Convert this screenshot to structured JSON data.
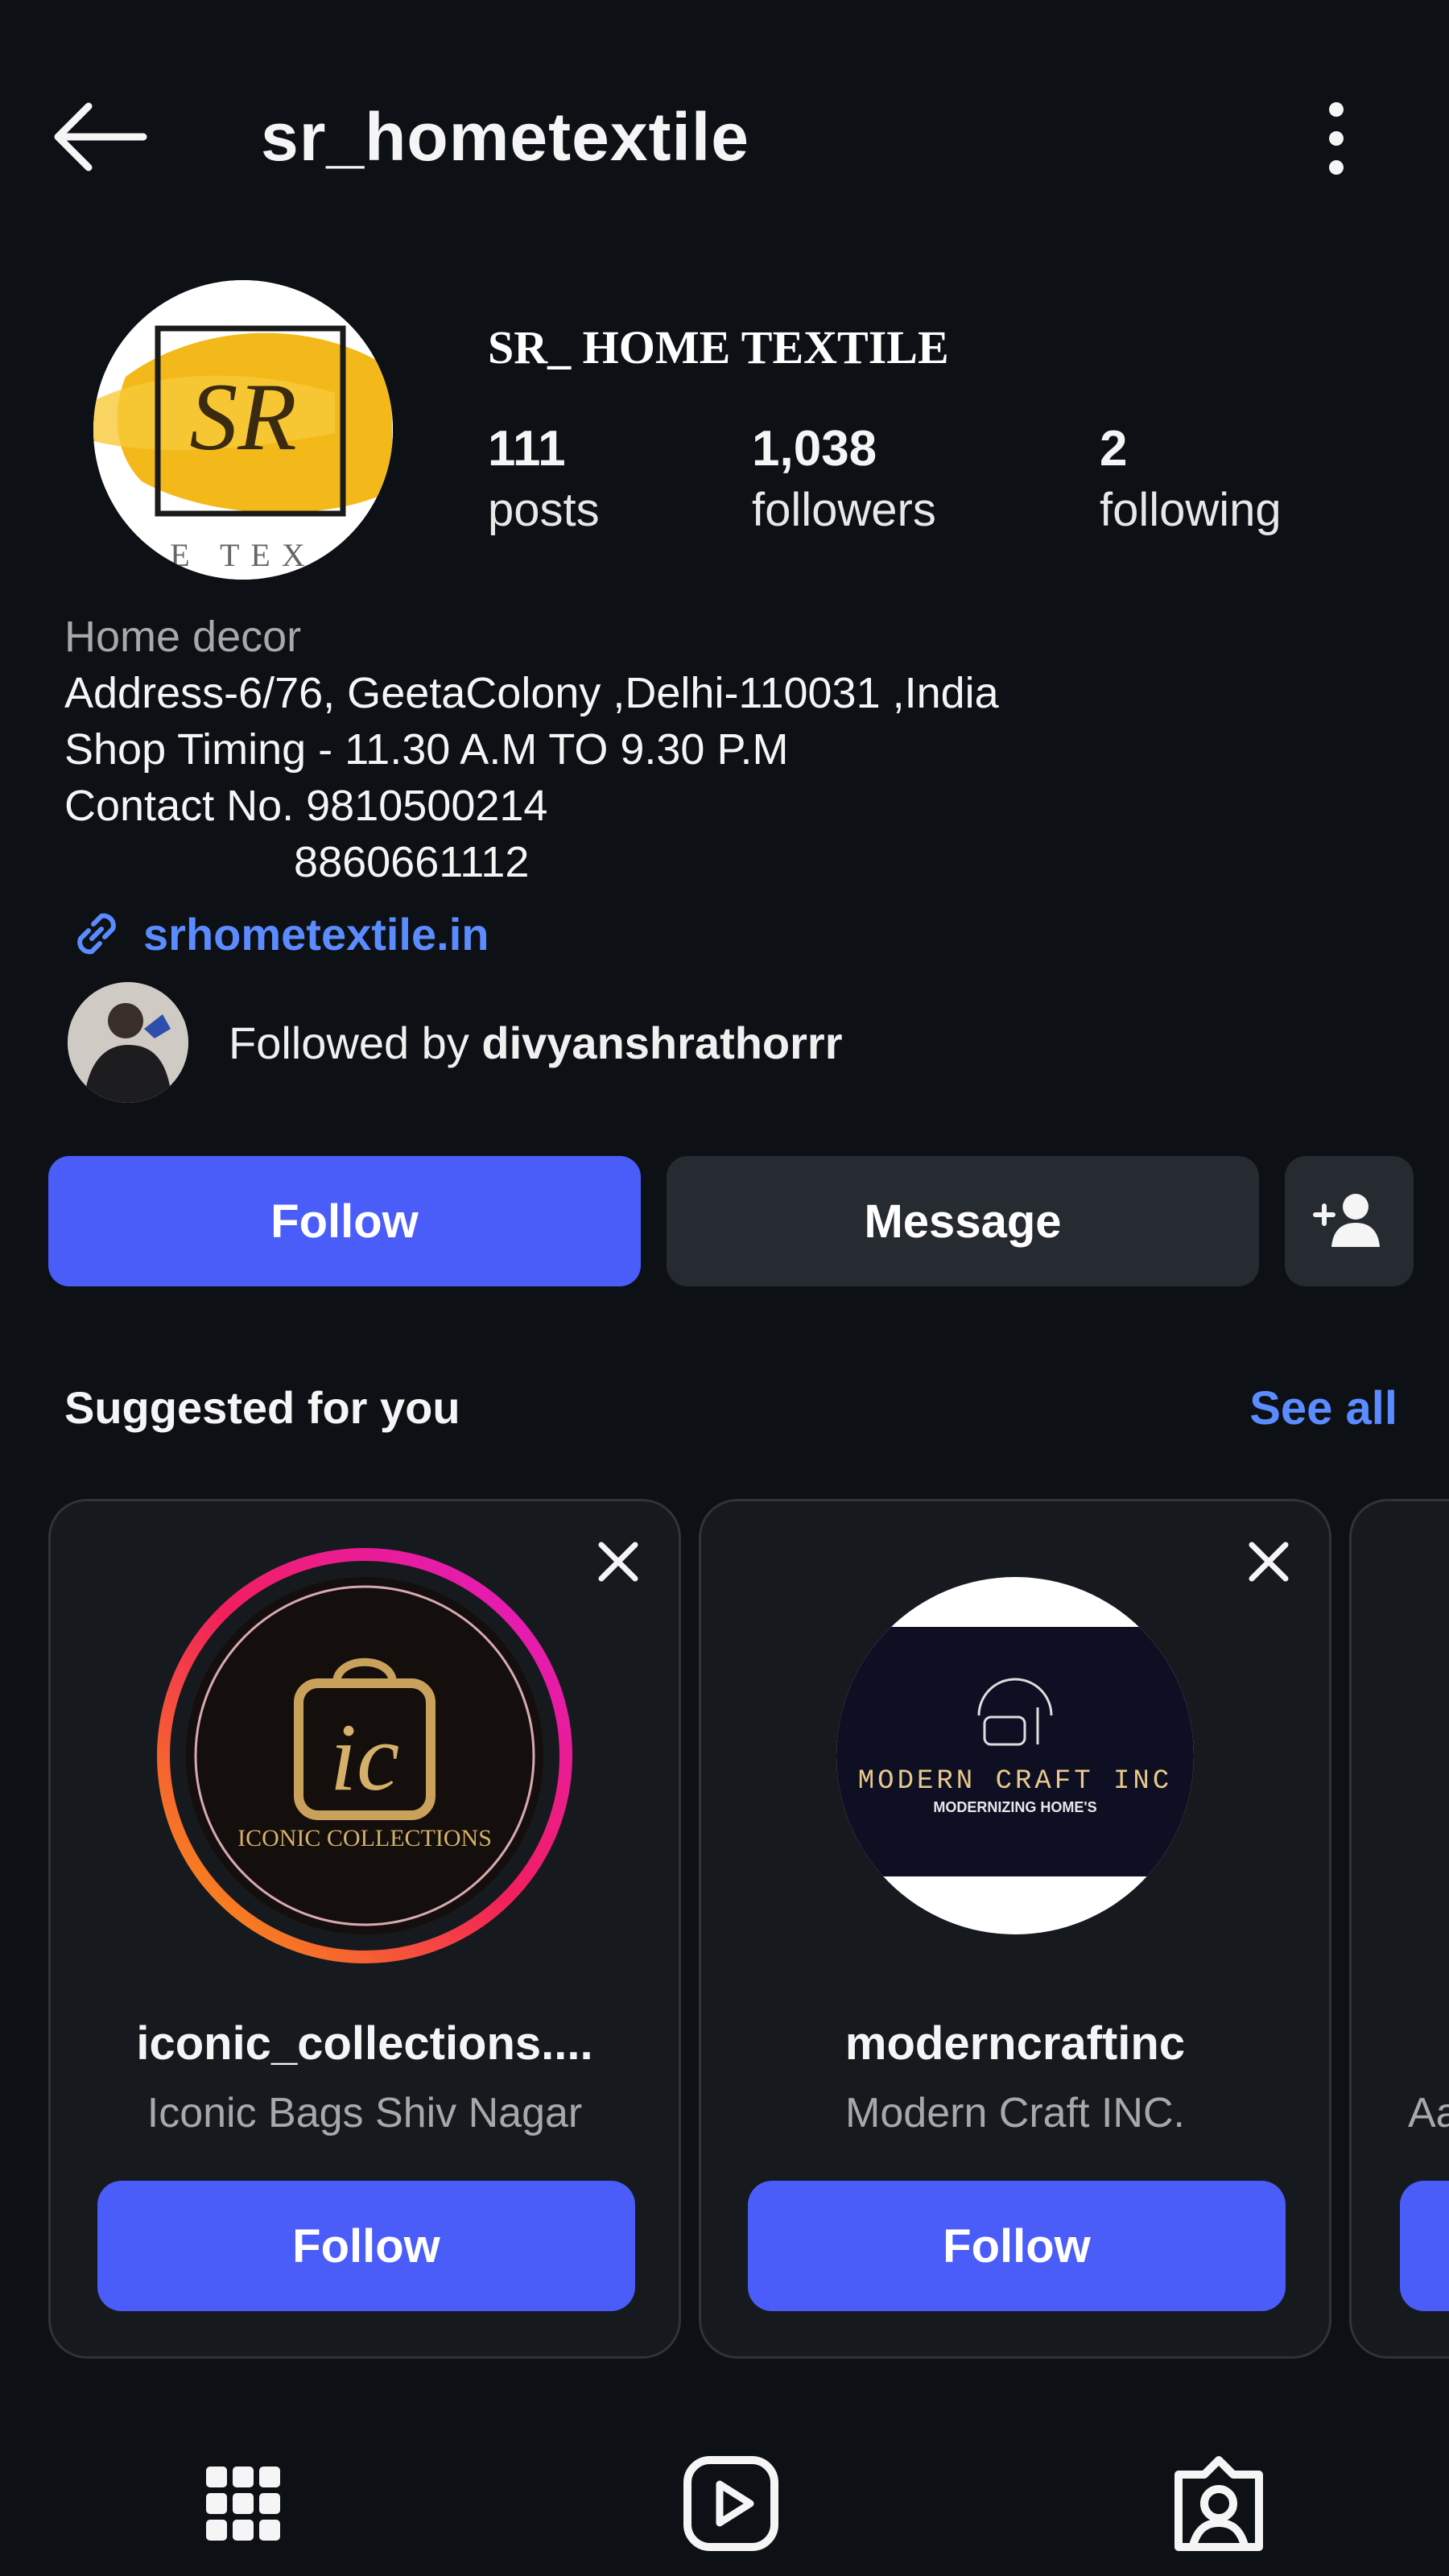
{
  "header": {
    "username": "sr_hometextile"
  },
  "profile": {
    "display_name": "SR_ HOME TEXTILE",
    "avatar_letters": "SR",
    "avatar_caption": "E TEX",
    "stats": {
      "posts_count": "111",
      "posts_label": "posts",
      "followers_count": "1,038",
      "followers_label": "followers",
      "following_count": "2",
      "following_label": "following"
    },
    "bio": {
      "category": "Home decor",
      "lines": [
        "Address-6/76, GeetaColony ,Delhi-110031 ,India",
        "Shop Timing - 11.30 A.M TO 9.30 P.M",
        "Contact No. 9810500214",
        "                   8860661112"
      ]
    },
    "link": "srhometextile.in",
    "followed_by_prefix": "Followed by ",
    "followed_by_user": "divyanshrathorrr"
  },
  "actions": {
    "follow_label": "Follow",
    "message_label": "Message"
  },
  "suggested": {
    "title": "Suggested for you",
    "see_all": "See all",
    "cards": [
      {
        "username": "iconic_collections....",
        "subtitle": "Iconic Bags Shiv Nagar",
        "follow_label": "Follow",
        "logo_text": "ic",
        "logo_caption": "ICONIC COLLECTIONS"
      },
      {
        "username": "moderncraftinc",
        "subtitle": "Modern Craft INC.",
        "follow_label": "Follow",
        "logo_text": "MODERN CRAFT INC",
        "logo_caption": "MODERNIZING HOME'S"
      },
      {
        "username": "",
        "subtitle": "Aa",
        "follow_label": ""
      }
    ]
  },
  "colors": {
    "background": "#0d1014",
    "primary_button": "#4a5df9",
    "secondary_button": "#262a31",
    "link": "#5b8cff",
    "muted_text": "#a8a8a8"
  },
  "tabs": [
    {
      "icon": "grid-icon"
    },
    {
      "icon": "reels-icon"
    },
    {
      "icon": "tagged-icon"
    }
  ]
}
